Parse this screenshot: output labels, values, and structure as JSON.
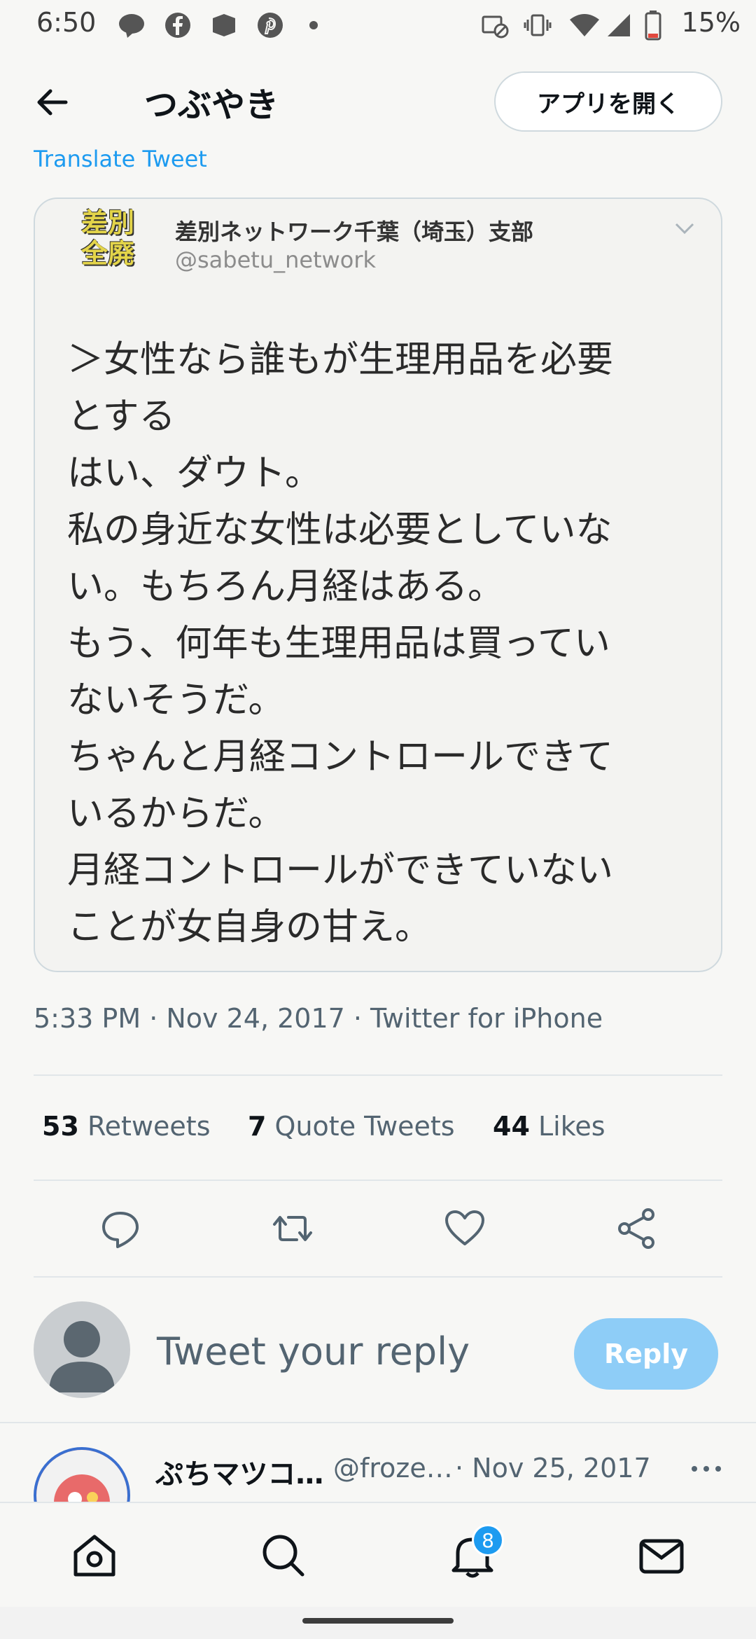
{
  "status": {
    "time": "6:50",
    "battery": "15%"
  },
  "header": {
    "title": "つぶやき",
    "open_app": "アプリを開く"
  },
  "translate": "Translate Tweet",
  "card": {
    "badge_line1": "差別",
    "badge_line2": "全廃",
    "name": "差別ネットワーク千葉（埼玉）支部",
    "handle": "@sabetu_network",
    "lines": [
      "＞女性なら誰もが生理用品を必要",
      "とする",
      "はい、ダウト。",
      "私の身近な女性は必要としていな",
      "い。もちろん月経はある。",
      "もう、何年も生理用品は買ってい",
      "ないそうだ。",
      "ちゃんと月経コントロールできて",
      "いるからだ。",
      "月経コントロールができていない",
      "ことが女自身の甘え。"
    ]
  },
  "meta": "5:33 PM · Nov 24, 2017 · Twitter for iPhone",
  "stats": {
    "retweets_count": "53",
    "retweets_label": "Retweets",
    "quotes_count": "7",
    "quotes_label": "Quote Tweets",
    "likes_count": "44",
    "likes_label": "Likes"
  },
  "reply": {
    "placeholder": "Tweet your reply",
    "button": "Reply"
  },
  "next_tweet": {
    "name": "ぷちマツコ…",
    "handle": "@froze…",
    "date": "· Nov 25, 2017"
  },
  "nav": {
    "notif_count": "8"
  },
  "icons": [
    "back-arrow-icon",
    "reply-icon",
    "retweet-icon",
    "like-icon",
    "share-icon",
    "home-icon",
    "search-icon",
    "bell-icon",
    "mail-icon",
    "more-icon"
  ],
  "colors": {
    "accent": "#1d9bf0",
    "reply_disabled": "#8ecdf7",
    "text_secondary": "#536471"
  }
}
